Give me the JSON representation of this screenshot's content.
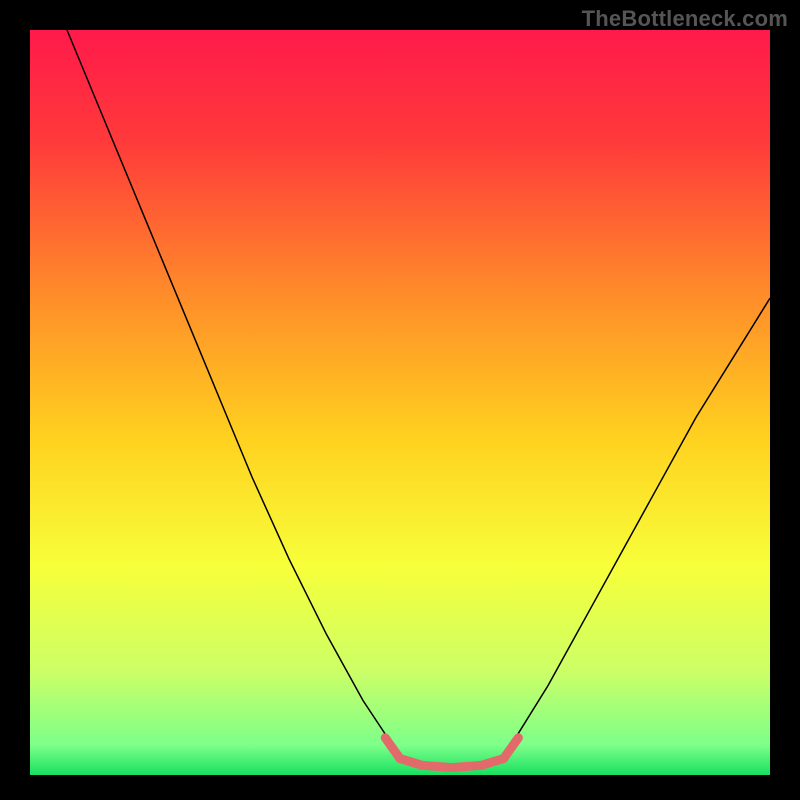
{
  "watermark": "TheBottleneck.com",
  "chart_data": {
    "type": "line",
    "title": "",
    "xlabel": "",
    "ylabel": "",
    "xlim": [
      0,
      100
    ],
    "ylim": [
      0,
      100
    ],
    "background_gradient": {
      "stops": [
        {
          "offset": 0.0,
          "color": "#ff1a4b"
        },
        {
          "offset": 0.15,
          "color": "#ff3a3a"
        },
        {
          "offset": 0.35,
          "color": "#ff8a2a"
        },
        {
          "offset": 0.55,
          "color": "#ffd21f"
        },
        {
          "offset": 0.72,
          "color": "#f7ff3a"
        },
        {
          "offset": 0.86,
          "color": "#ccff66"
        },
        {
          "offset": 0.96,
          "color": "#7dff8a"
        },
        {
          "offset": 1.0,
          "color": "#17e060"
        }
      ]
    },
    "series": [
      {
        "name": "left-curve",
        "color": "#000000",
        "width": 1.5,
        "points": [
          {
            "x": 5,
            "y": 100
          },
          {
            "x": 10,
            "y": 88
          },
          {
            "x": 15,
            "y": 76
          },
          {
            "x": 20,
            "y": 64
          },
          {
            "x": 25,
            "y": 52
          },
          {
            "x": 30,
            "y": 40
          },
          {
            "x": 35,
            "y": 29
          },
          {
            "x": 40,
            "y": 19
          },
          {
            "x": 45,
            "y": 10
          },
          {
            "x": 49,
            "y": 4
          }
        ]
      },
      {
        "name": "right-curve",
        "color": "#000000",
        "width": 1.5,
        "points": [
          {
            "x": 65,
            "y": 4
          },
          {
            "x": 70,
            "y": 12
          },
          {
            "x": 75,
            "y": 21
          },
          {
            "x": 80,
            "y": 30
          },
          {
            "x": 85,
            "y": 39
          },
          {
            "x": 90,
            "y": 48
          },
          {
            "x": 95,
            "y": 56
          },
          {
            "x": 100,
            "y": 64
          }
        ]
      },
      {
        "name": "valley-highlight",
        "color": "#e26a6a",
        "width": 9,
        "linecap": "round",
        "points": [
          {
            "x": 48,
            "y": 5
          },
          {
            "x": 50,
            "y": 2.2
          },
          {
            "x": 53,
            "y": 1.3
          },
          {
            "x": 57,
            "y": 1.0
          },
          {
            "x": 61,
            "y": 1.3
          },
          {
            "x": 64,
            "y": 2.2
          },
          {
            "x": 66,
            "y": 5
          }
        ]
      }
    ]
  }
}
